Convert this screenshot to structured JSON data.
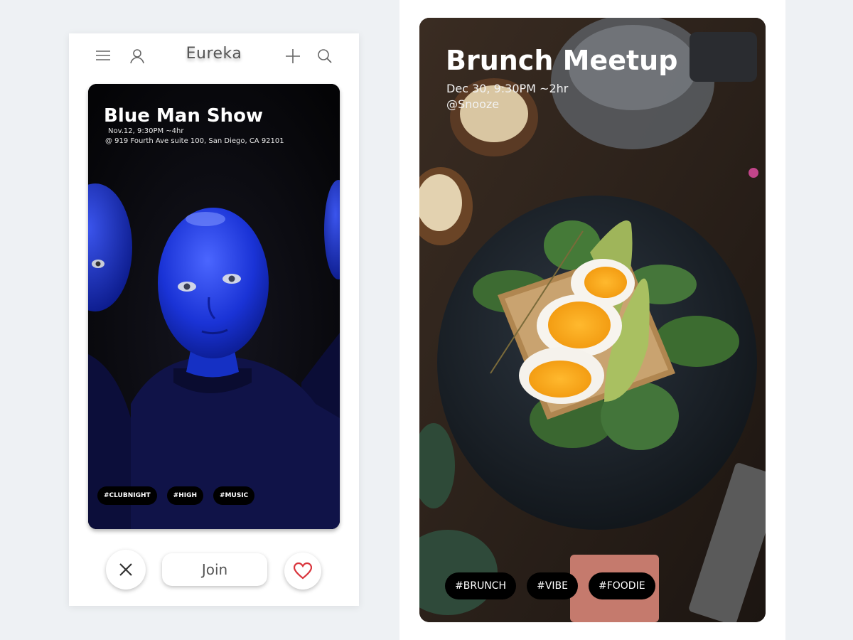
{
  "left_screen": {
    "app_title": "Eureka",
    "event": {
      "title": "Blue Man Show",
      "when": "Nov.12, 9:30PM ~4hr",
      "where": "@ 919 Fourth Ave suite 100, San Diego, CA 92101",
      "tags": [
        "#CLUBNIGHT",
        "#HIGH",
        "#MUSIC"
      ]
    },
    "actions": {
      "join_label": "Join"
    },
    "icons": {
      "menu": "hamburger-menu-icon",
      "profile": "user-icon",
      "add": "plus-icon",
      "search": "search-icon",
      "dismiss": "close-icon",
      "like": "heart-icon"
    },
    "colors": {
      "heart": "#d9343c",
      "tag_bg": "#000000"
    }
  },
  "right_screen": {
    "event": {
      "title": "Brunch Meetup",
      "when": "Dec 30, 9:30PM ~2hr",
      "where": "@Snooze",
      "tags": [
        "#BRUNCH",
        "#VIBE",
        "#FOODIE"
      ]
    }
  }
}
